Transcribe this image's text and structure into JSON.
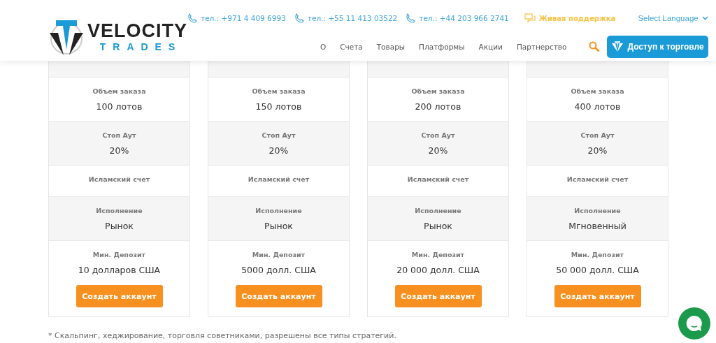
{
  "header": {
    "contacts": [
      {
        "kind": "phone",
        "text": "тел.: +971 4 409 6993"
      },
      {
        "kind": "phone",
        "text": "тел.: +55 11 413 03522"
      },
      {
        "kind": "phone",
        "text": "тел.: +44 203 966 2741"
      },
      {
        "kind": "chat",
        "text": "Живая поддержка"
      }
    ],
    "language": "Select Language",
    "logo": {
      "line1": "VELOCITY",
      "line2": "TRADES"
    },
    "nav": [
      "О",
      "Счета",
      "Товары",
      "Платформы",
      "Акции",
      "Партнерство"
    ],
    "access_button": "Доступ к торговле"
  },
  "plans": [
    {
      "rows": [
        {
          "label": "Объем заказа",
          "value": "100 лотов"
        },
        {
          "label": "Стоп Аут",
          "value": "20%"
        },
        {
          "label": "Исламский счет"
        },
        {
          "label": "Исполнение",
          "value": "Рынок"
        },
        {
          "label": "Мин. Депозит",
          "value": "10 долларов США"
        }
      ],
      "button": "Создать аккаунт"
    },
    {
      "rows": [
        {
          "label": "Объем заказа",
          "value": "150 лотов"
        },
        {
          "label": "Стоп Аут",
          "value": "20%"
        },
        {
          "label": "Исламский счет"
        },
        {
          "label": "Исполнение",
          "value": "Рынок"
        },
        {
          "label": "Мин. Депозит",
          "value": "5000 долл. США"
        }
      ],
      "button": "Создать аккаунт"
    },
    {
      "rows": [
        {
          "label": "Объем заказа",
          "value": "200 лотов"
        },
        {
          "label": "Стоп Аут",
          "value": "20%"
        },
        {
          "label": "Исламский счет"
        },
        {
          "label": "Исполнение",
          "value": "Рынок"
        },
        {
          "label": "Мин. Депозит",
          "value": "20 000 долл. США"
        }
      ],
      "button": "Создать аккаунт"
    },
    {
      "rows": [
        {
          "label": "Объем заказа",
          "value": "400 лотов"
        },
        {
          "label": "Стоп Аут",
          "value": "20%"
        },
        {
          "label": "Исламский счет"
        },
        {
          "label": "Исполнение",
          "value": "Мгновенный"
        },
        {
          "label": "Мин. Депозит",
          "value": "50 000 долл. США"
        }
      ],
      "button": "Создать аккаунт"
    }
  ],
  "footnote": "* Скальпинг, хеджирование, торговля советниками, разрешены все типы стратегий."
}
